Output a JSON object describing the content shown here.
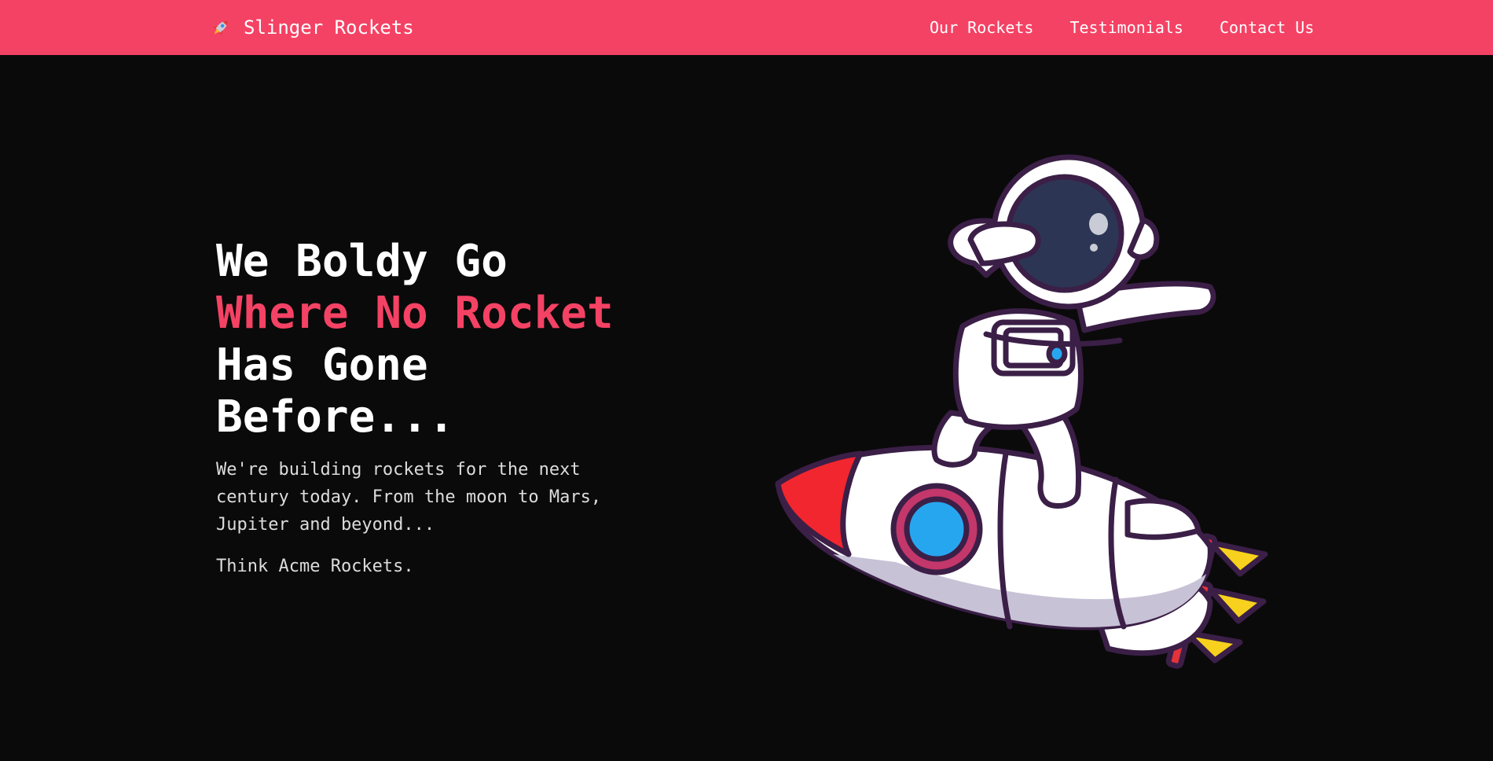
{
  "nav": {
    "brand": "Slinger Rockets",
    "brand_icon": "rocket-icon",
    "links": [
      "Our Rockets",
      "Testimonials",
      "Contact Us"
    ]
  },
  "hero": {
    "headline": {
      "part1": "We Boldy Go",
      "accent": "Where No Rocket",
      "part2": "Has Gone Before..."
    },
    "subtitle": "We're building rockets for the next century today. From the moon to Mars, Jupiter and beyond...",
    "tagline": "Think Acme Rockets.",
    "illustration": "astronaut-riding-rocket"
  },
  "colors": {
    "accent": "#f44264",
    "background": "#0a0a0a",
    "text": "#ffffff"
  }
}
